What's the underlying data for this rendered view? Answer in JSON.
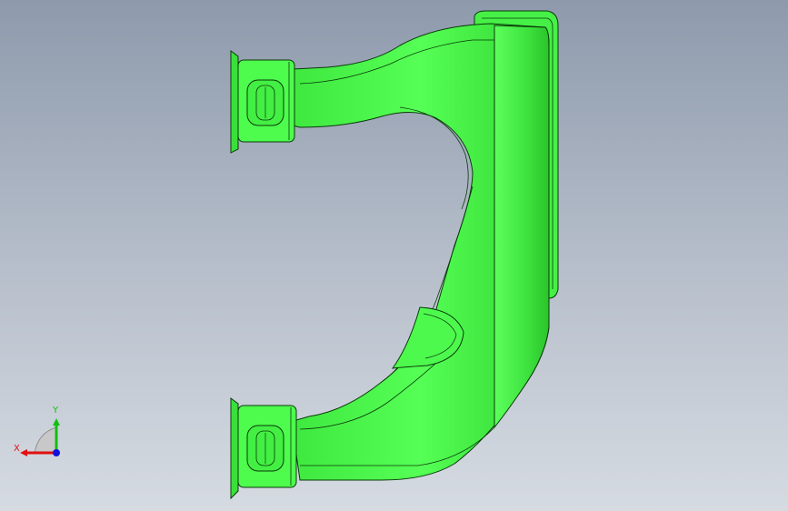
{
  "viewport": {
    "background_top": "#8e9aac",
    "background_bottom": "#d6dbe2"
  },
  "model": {
    "part_color": "#4cff4c",
    "part_shade": "#2ed62e",
    "edge_color": "#0a3a0a"
  },
  "triad": {
    "x_label": "X",
    "y_label": "Y",
    "x_color": "#e01010",
    "y_color": "#10c010",
    "z_color": "#1010e0"
  }
}
